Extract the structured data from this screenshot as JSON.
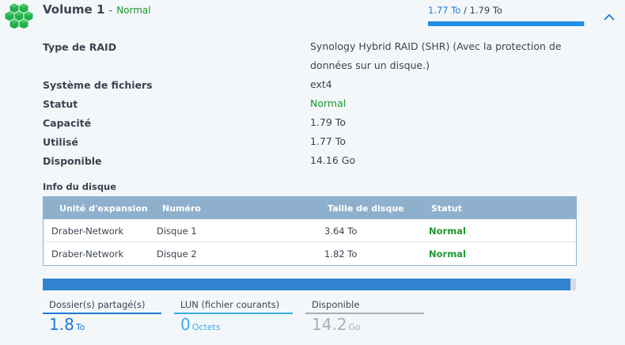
{
  "volume": {
    "name": "Volume 1",
    "separator": "-",
    "status": "Normal",
    "usage_used": "1.77 To",
    "usage_sep": "/",
    "usage_total": "1.79 To",
    "usage_fraction": 0.99
  },
  "properties": [
    {
      "label": "Type de RAID",
      "value_line1": "Synology Hybrid RAID (SHR) (Avec la protection de",
      "value_line2": "données sur un disque.)"
    },
    {
      "label": "Système de fichiers",
      "value": "ext4"
    },
    {
      "label": "Statut",
      "value": "Normal"
    },
    {
      "label": "Capacité",
      "value": "1.79 To"
    },
    {
      "label": "Utilisé",
      "value": "1.77 To"
    },
    {
      "label": "Disponible",
      "value": "14.16 Go"
    }
  ],
  "disk_info": {
    "heading": "Info du disque",
    "columns": [
      "Unité d'expansion",
      "Numéro",
      "Taille de disque",
      "Statut"
    ],
    "rows": [
      {
        "unit": "Draber-Network",
        "number": "Disque 1",
        "size": "3.64 To",
        "status": "Normal"
      },
      {
        "unit": "Draber-Network",
        "number": "Disque 2",
        "size": "1.82 To",
        "status": "Normal"
      }
    ]
  },
  "allocation_fraction": 0.99,
  "stats": [
    {
      "label": "Dossier(s) partagé(s)",
      "value": "1.8",
      "unit": "To"
    },
    {
      "label": "LUN (fichier courants)",
      "value": "0",
      "unit": "Octets"
    },
    {
      "label": "Disponible",
      "value": "14.2",
      "unit": "Go"
    }
  ],
  "colors": {
    "accent": "#1e7ad6",
    "ok": "#1a9a2e",
    "header": "#8fb0cc",
    "cube": "#22b04a"
  },
  "icons": {
    "volume": "green-cubes-icon",
    "collapse": "chevron-up-icon"
  }
}
